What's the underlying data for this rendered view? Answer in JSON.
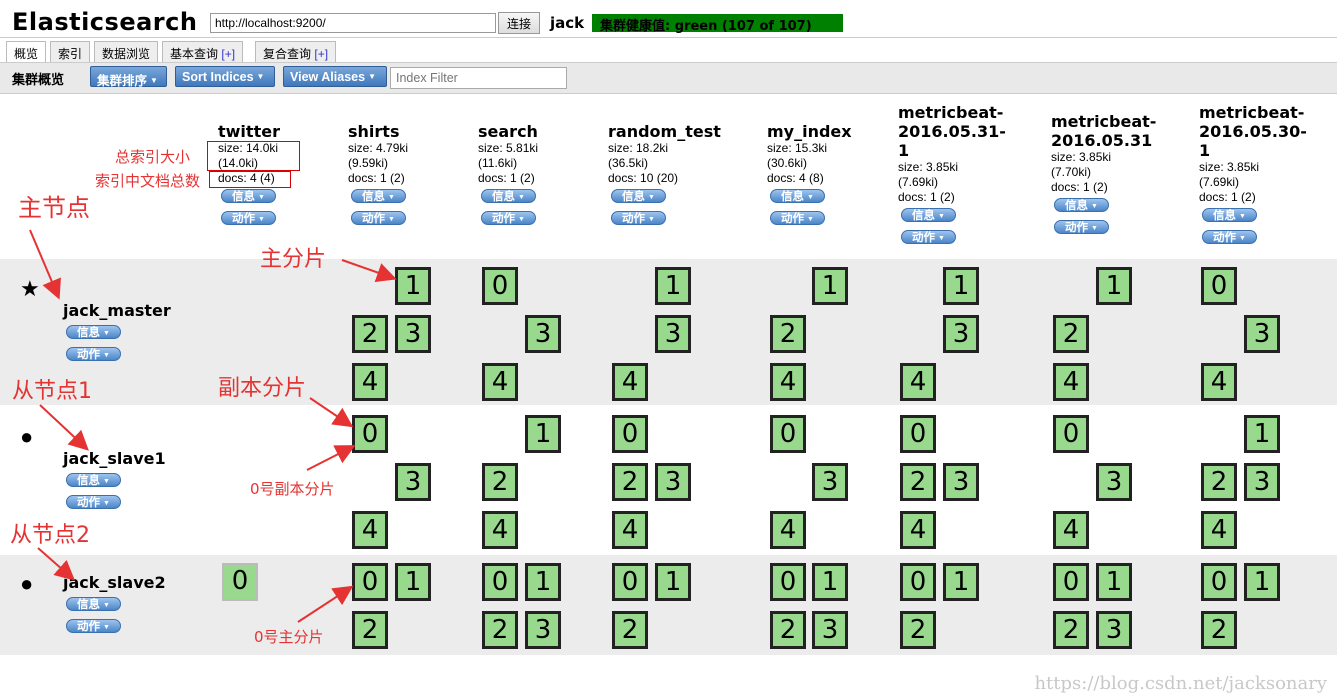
{
  "header": {
    "title": "Elasticsearch",
    "url_value": "http://localhost:9200/",
    "connect_label": "连接",
    "cluster_name": "jack",
    "health_text": "集群健康值: green (107 of 107)",
    "health_color": "#008000"
  },
  "tabs": [
    {
      "label": "概览",
      "active": true
    },
    {
      "label": "索引"
    },
    {
      "label": "数据浏览"
    },
    {
      "label": "基本查询",
      "plus": "[+]"
    },
    {
      "label": "复合查询",
      "plus": "[+]"
    }
  ],
  "toolbar": {
    "label": "集群概览",
    "sort_cluster": "集群排序",
    "sort_indices": "Sort Indices",
    "view_aliases": "View Aliases",
    "filter_placeholder": "Index Filter"
  },
  "pill_labels": {
    "info": "信息",
    "action": "动作"
  },
  "indices": [
    {
      "name": "twitter",
      "size": "size: 14.0ki",
      "size2": "(14.0ki)",
      "docs": "docs: 4 (4)"
    },
    {
      "name": "shirts",
      "size": "size: 4.79ki",
      "size2": "(9.59ki)",
      "docs": "docs: 1 (2)"
    },
    {
      "name": "search",
      "size": "size: 5.81ki",
      "size2": "(11.6ki)",
      "docs": "docs: 1 (2)"
    },
    {
      "name": "random_test",
      "size": "size: 18.2ki",
      "size2": "(36.5ki)",
      "docs": "docs: 10 (20)"
    },
    {
      "name": "my_index",
      "size": "size: 15.3ki",
      "size2": "(30.6ki)",
      "docs": "docs: 4 (8)"
    },
    {
      "name1": "metricbeat-",
      "name2": "2016.05.31-",
      "name3": "1",
      "size": "size: 3.85ki",
      "size2": "(7.69ki)",
      "docs": "docs: 1 (2)"
    },
    {
      "name1": "metricbeat-",
      "name2": "2016.05.31",
      "size": "size: 3.85ki",
      "size2": "(7.70ki)",
      "docs": "docs: 1 (2)"
    },
    {
      "name1": "metricbeat-",
      "name2": "2016.05.30-",
      "name3": "1",
      "size": "size: 3.85ki",
      "size2": "(7.69ki)",
      "docs": "docs: 1 (2)"
    }
  ],
  "nodes": [
    {
      "name": "jack_master",
      "icon": "star-icon"
    },
    {
      "name": "jack_slave1",
      "icon": "circle-icon"
    },
    {
      "name": "jack_slave2",
      "icon": "circle-icon"
    }
  ],
  "shard_labels": [
    "0",
    "1",
    "2",
    "3",
    "4"
  ],
  "annotations": {
    "total_size": "总索引大小",
    "total_docs": "索引中文档总数",
    "master_node": "主节点",
    "primary_shard": "主分片",
    "slave1": "从节点1",
    "replica_shard": "副本分片",
    "replica_0": "0号副本分片",
    "slave2": "从节点2",
    "primary_0": "0号主分片"
  },
  "watermark": "https://blog.csdn.net/jacksonary"
}
